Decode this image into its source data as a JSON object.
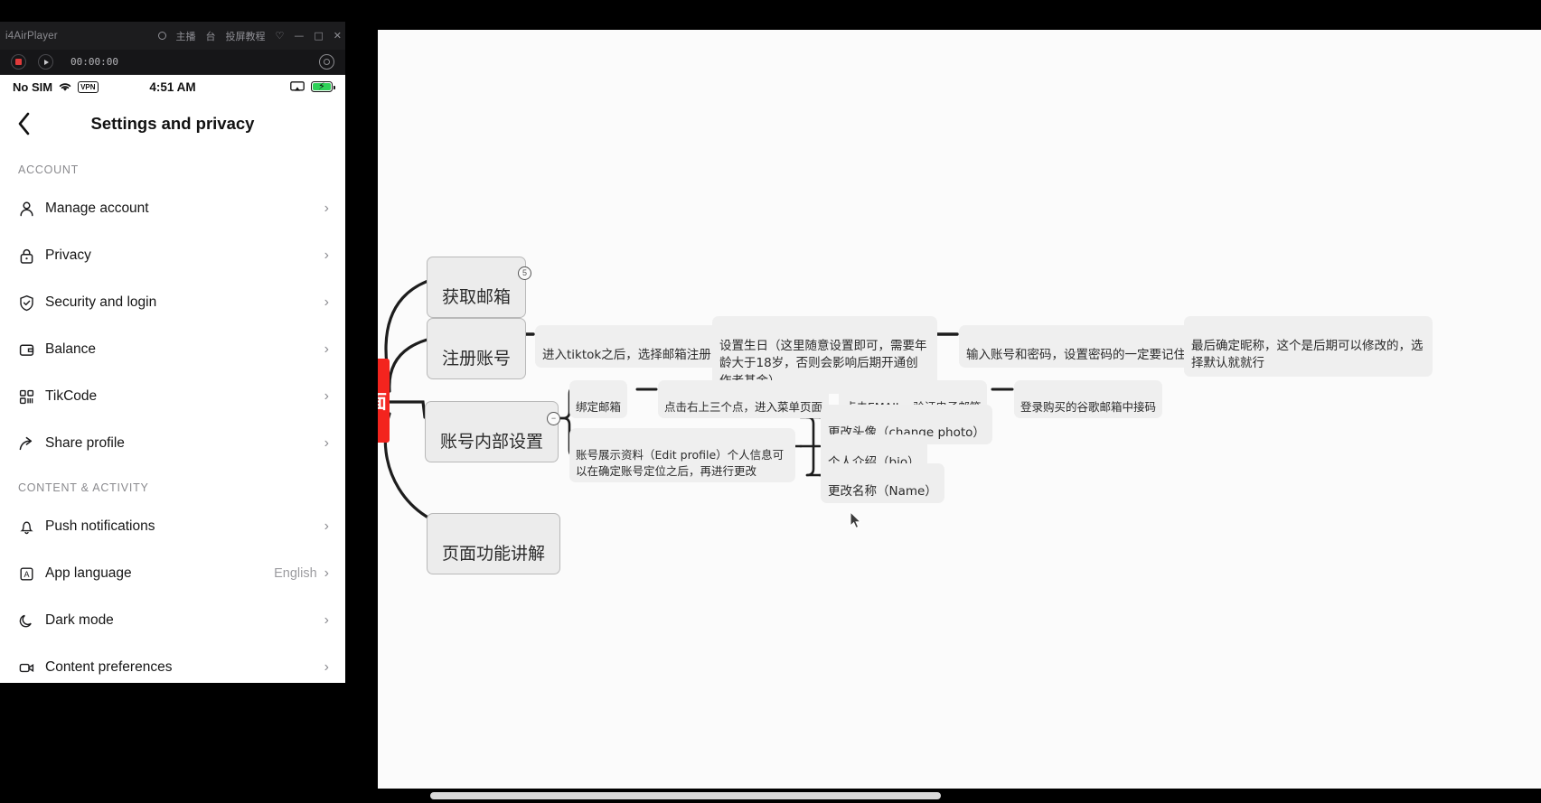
{
  "mirror_window": {
    "app_title": "i4AirPlayer",
    "menu_items": [
      "主播",
      "台",
      "投屏教程"
    ],
    "window_controls": [
      "—",
      "□",
      "✕"
    ],
    "toolbar": {
      "record_label": "record",
      "play_label": "play",
      "timer": "00:00:00",
      "capture_label": "capture"
    }
  },
  "phone": {
    "status_bar": {
      "carrier": "No SIM",
      "wifi_icon": "wifi-icon",
      "vpn_badge": "VPN",
      "time": "4:51 AM",
      "airplay_icon": "screen-mirror-icon",
      "battery_icon": "battery-charging-icon"
    },
    "header": {
      "back_icon": "chevron-left-icon",
      "title": "Settings and privacy"
    },
    "sections": [
      {
        "label": "ACCOUNT",
        "items": [
          {
            "icon": "person-icon",
            "label": "Manage account",
            "value": "",
            "chevron": "›"
          },
          {
            "icon": "lock-icon",
            "label": "Privacy",
            "value": "",
            "chevron": "›"
          },
          {
            "icon": "shield-check-icon",
            "label": "Security and login",
            "value": "",
            "chevron": "›"
          },
          {
            "icon": "wallet-icon",
            "label": "Balance",
            "value": "",
            "chevron": "›"
          },
          {
            "icon": "qrcode-icon",
            "label": "TikCode",
            "value": "",
            "chevron": "›"
          },
          {
            "icon": "share-arrow-icon",
            "label": "Share profile",
            "value": "",
            "chevron": "›"
          }
        ]
      },
      {
        "label": "CONTENT & ACTIVITY",
        "items": [
          {
            "icon": "bell-icon",
            "label": "Push notifications",
            "value": "",
            "chevron": "›"
          },
          {
            "icon": "language-icon",
            "label": "App language",
            "value": "English",
            "chevron": "›"
          },
          {
            "icon": "moon-icon",
            "label": "Dark mode",
            "value": "",
            "chevron": "›"
          },
          {
            "icon": "video-icon",
            "label": "Content preferences",
            "value": "",
            "chevron": "›"
          }
        ]
      }
    ]
  },
  "mindmap": {
    "root": {
      "text": "面",
      "color": "#f3241e"
    },
    "branch_get_email": {
      "title": "获取邮箱",
      "badge": "5"
    },
    "branch_register": {
      "title": "注册账号",
      "steps": [
        "进入tiktok之后，选择邮箱注册",
        "设置生日（这里随意设置即可，需要年龄大于18岁，否则会影响后期开通创作者基金）",
        "输入账号和密码，设置密码的一定要记住",
        "最后确定昵称，这个是后期可以修改的，选择默认就就行"
      ]
    },
    "branch_account_settings": {
      "title": "账号内部设置",
      "badge": "−",
      "email_chain": [
        "绑定邮箱",
        "点击右上三个点，进入菜单页面",
        "点击EMAIL，验证电子邮箱",
        "登录购买的谷歌邮箱中接码"
      ],
      "profile_node": "账号展示资料（Edit profile）个人信息可以在确定账号定位之后，再进行更改",
      "profile_children": [
        "更改头像（change photo）",
        "个人介绍（bio）",
        "更改名称（Name）"
      ]
    },
    "branch_page_features": {
      "title": "页面功能讲解"
    }
  }
}
